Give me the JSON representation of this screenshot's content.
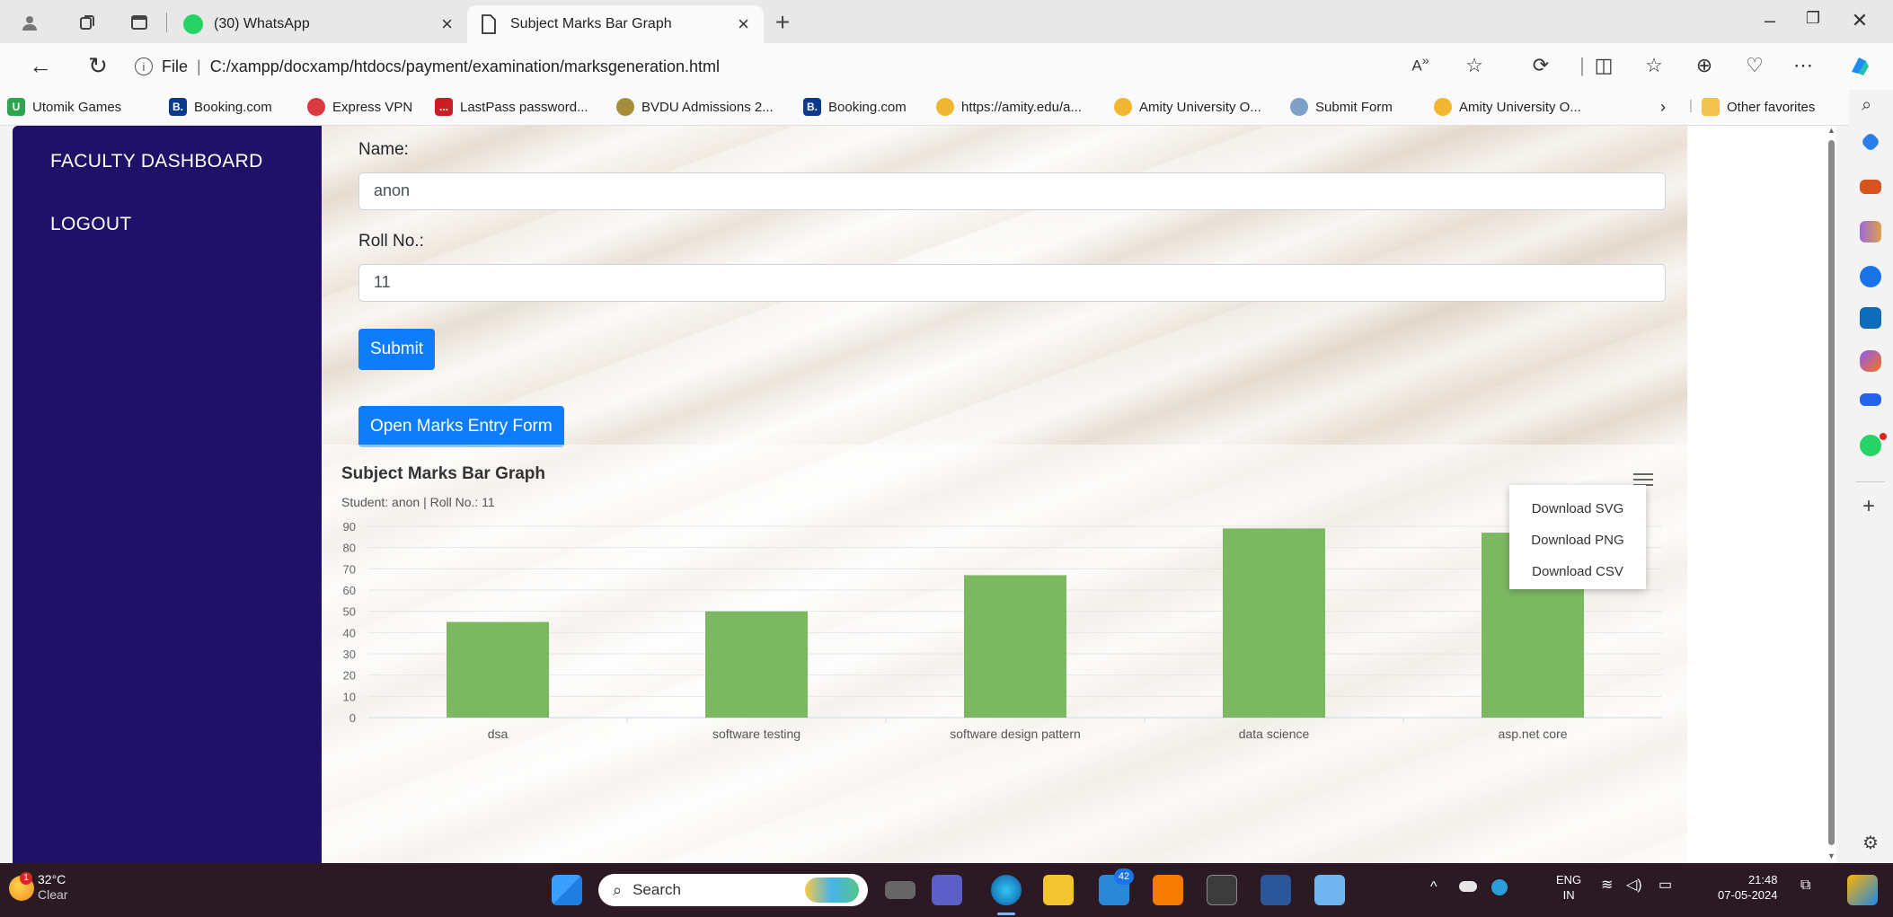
{
  "browser": {
    "tabs": [
      {
        "title": "(30) WhatsApp",
        "active": false
      },
      {
        "title": "Subject Marks Bar Graph",
        "active": true
      }
    ],
    "address": {
      "scheme_label": "File",
      "url": "C:/xampp/docxamp/htdocs/payment/examination/marksgeneration.html"
    },
    "favorites": [
      {
        "label": "Utomik Games",
        "color": "#2ea44f",
        "glyph": "U"
      },
      {
        "label": "Booking.com",
        "color": "#0b3a8c",
        "glyph": "B."
      },
      {
        "label": "Express VPN",
        "color": "#da3940",
        "glyph": ""
      },
      {
        "label": "LastPass password...",
        "color": "#cc1c24",
        "glyph": "..."
      },
      {
        "label": "BVDU Admissions 2...",
        "color": "#a68d3c",
        "glyph": ""
      },
      {
        "label": "Booking.com",
        "color": "#0b3a8c",
        "glyph": "B."
      },
      {
        "label": "https://amity.edu/a...",
        "color": "#f2b632",
        "glyph": ""
      },
      {
        "label": "Amity University O...",
        "color": "#f2b632",
        "glyph": ""
      },
      {
        "label": "Submit Form",
        "color": "#7fa0c7",
        "glyph": ""
      },
      {
        "label": "Amity University O...",
        "color": "#f2b632",
        "glyph": ""
      }
    ],
    "other_favorites": "Other favorites"
  },
  "sidebar": {
    "items": [
      {
        "label": "FACULTY DASHBOARD"
      },
      {
        "label": "LOGOUT"
      }
    ]
  },
  "form": {
    "name_label": "Name:",
    "name_value": "anon",
    "roll_label": "Roll No.:",
    "roll_value": "11",
    "submit_label": "Submit",
    "open_form_label": "Open Marks Entry Form"
  },
  "chart_menu": {
    "items": [
      "Download SVG",
      "Download PNG",
      "Download CSV"
    ]
  },
  "chart_data": {
    "type": "bar",
    "title": "Subject Marks Bar Graph",
    "subtitle": "Student: anon | Roll No.: 11",
    "categories": [
      "dsa",
      "software testing",
      "software design pattern",
      "data science",
      "asp.net core"
    ],
    "values": [
      45,
      50,
      67,
      89,
      87
    ],
    "ylim": [
      0,
      90
    ],
    "yticks": [
      0,
      10,
      20,
      30,
      40,
      50,
      60,
      70,
      80,
      90
    ],
    "bar_color": "#7cb862",
    "grid": true,
    "legend": false
  },
  "taskbar": {
    "weather_temp": "32°C",
    "weather_desc": "Clear",
    "weather_badge": "1",
    "search_label": "Search",
    "teams_badge": "42",
    "lang_top": "ENG",
    "lang_bottom": "IN",
    "time": "21:48",
    "date": "07-05-2024"
  },
  "colors": {
    "sidebar_bg": "#1f1168",
    "button_bg": "#0d7dfc",
    "bar": "#7cb862"
  }
}
